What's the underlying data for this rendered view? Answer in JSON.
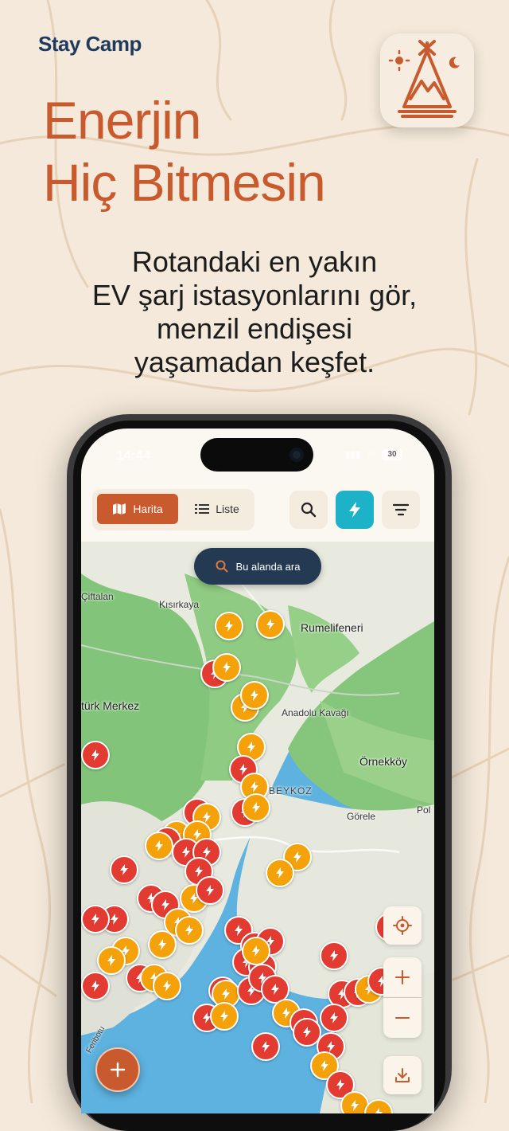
{
  "brand": "Stay Camp",
  "headline": [
    "Enerjin",
    "Hiç Bitmesin"
  ],
  "subhead": [
    "Rotandaki en yakın",
    "EV şarj istasyonlarını gör,",
    "menzil endişesi",
    "yaşamadan keşfet."
  ],
  "status": {
    "time": "14:44",
    "battery": "30"
  },
  "toolbar": {
    "map_label": "Harita",
    "list_label": "Liste",
    "icons": {
      "map": "map-icon",
      "list": "list-icon",
      "search": "search-icon",
      "charge": "lightning-icon",
      "filter": "filter-icon"
    }
  },
  "map": {
    "search_area_label": "Bu alanda ara",
    "place_labels": [
      "Çiftalan",
      "Kısırkaya",
      "Rumelifeneri",
      "türk Merkez",
      "Anadolu Kavağı",
      "Örnekköy",
      "BEYKOZ",
      "Görele",
      "Pol",
      "Feribotu"
    ],
    "controls": [
      "locate-icon",
      "zoom-in-icon",
      "zoom-out-icon",
      "download-icon"
    ]
  },
  "colors": {
    "accent": "#c95a2e",
    "navy": "#1f3a5c",
    "teal": "#1eb2c9",
    "station_red": "#e33b32",
    "station_orange": "#f5a20a",
    "background": "#f4e9da"
  }
}
